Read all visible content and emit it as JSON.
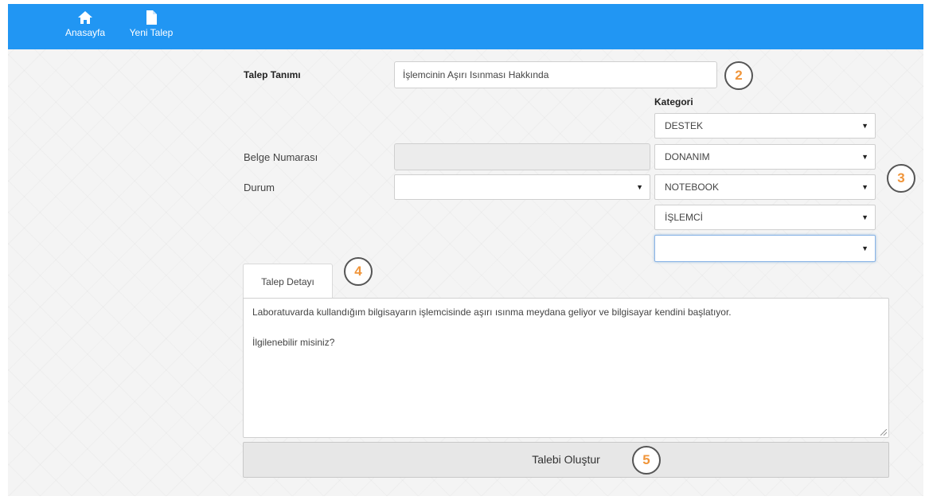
{
  "nav": {
    "home_label": "Anasayfa",
    "new_request_label": "Yeni Talep",
    "home_icon": "home-icon",
    "new_request_icon": "file-icon",
    "bar_color": "#2196f3"
  },
  "form": {
    "title_label": "Talep Tanımı",
    "title_value": "İşlemcinin Aşırı Isınması Hakkında",
    "category_label": "Kategori",
    "document_number_label": "Belge Numarası",
    "document_number_value": "",
    "status_label": "Durum",
    "status_value": ""
  },
  "categories": [
    {
      "value": "DESTEK"
    },
    {
      "value": "DONANIM"
    },
    {
      "value": "NOTEBOOK"
    },
    {
      "value": "İŞLEMCİ"
    },
    {
      "value": ""
    }
  ],
  "detail": {
    "tab_label": "Talep Detayı",
    "line1": "Laboratuvarda kullandığım bilgisayarın işlemcisinde aşırı ısınma meydana geliyor ve bilgisayar kendini başlatıyor.",
    "line2": "İlgilenebilir misiniz?"
  },
  "submit_label": "Talebi Oluştur",
  "annotations": {
    "step2": "2",
    "step3": "3",
    "step4": "4",
    "step5": "5",
    "color": "#f0953a"
  }
}
